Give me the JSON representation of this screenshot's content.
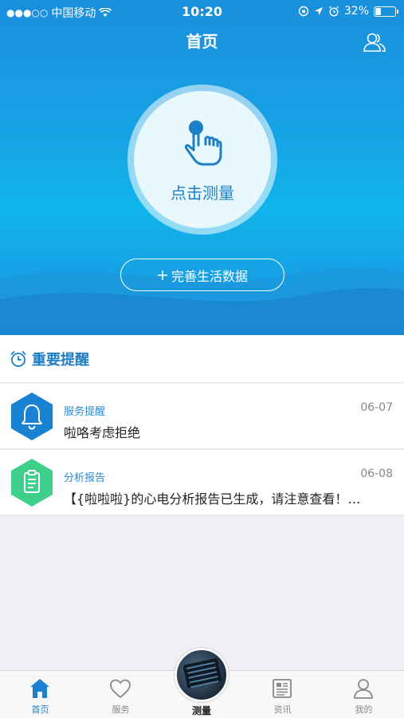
{
  "status_bar": {
    "signal_dots": "●●●○○",
    "carrier": "中国移动",
    "time": "10:20",
    "battery": "32%",
    "battery_level": 0.32
  },
  "nav": {
    "title": "首页"
  },
  "hero": {
    "measure_label": "点击测量",
    "life_data_button": "完善生活数据"
  },
  "reminders": {
    "title": "重要提醒",
    "items": [
      {
        "category": "服务提醒",
        "date": "06-07",
        "text": "啦咯考虑拒绝",
        "icon": "bell-icon",
        "color": "#1a82d2"
      },
      {
        "category": "分析报告",
        "date": "06-08",
        "text": "【{啦啦啦}的心电分析报告已生成，请注意查看！…",
        "icon": "clipboard-icon",
        "color": "#3ed08a"
      }
    ]
  },
  "tabs": [
    {
      "label": "首页",
      "icon": "home-icon",
      "active": true
    },
    {
      "label": "服务",
      "icon": "heart-icon",
      "active": false
    },
    {
      "label": "测量",
      "icon": "device-photo",
      "active": false
    },
    {
      "label": "资讯",
      "icon": "news-icon",
      "active": false
    },
    {
      "label": "我的",
      "icon": "profile-icon",
      "active": false
    }
  ],
  "colors": {
    "primary": "#1a82d2",
    "accent_green": "#3ed08a"
  }
}
